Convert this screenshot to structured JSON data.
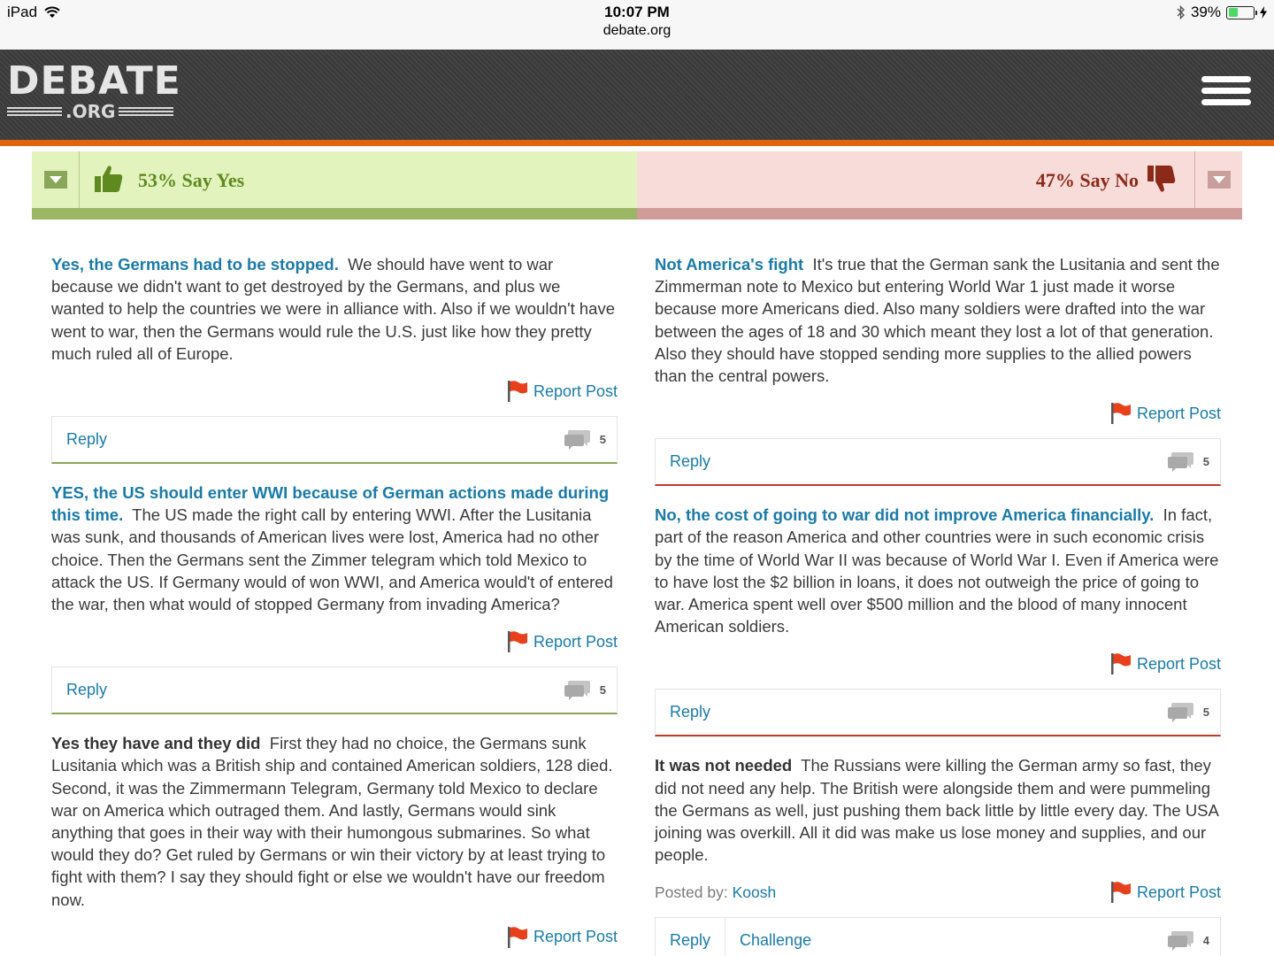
{
  "status_bar": {
    "device": "iPad",
    "time": "10:07 PM",
    "url": "debate.org",
    "battery": "39%",
    "battery_level": 0.39
  },
  "header": {
    "logo_main": "DEBATE",
    "logo_sub": ".ORG"
  },
  "colors": {
    "accent_orange": "#e1640f",
    "yes_green": "#5f8a1f",
    "no_red": "#8c2a1a",
    "link_blue": "#1a7aa8"
  },
  "vote": {
    "yes_label": "53% Say Yes",
    "no_label": "47% Say No",
    "yes_percent": 53,
    "no_percent": 47
  },
  "yes_arguments": [
    {
      "title": "Yes, the Germans had to be stopped.",
      "body": "We should have went to war because we didn't want to get destroyed by the Germans, and plus we wanted to help the countries we were in alliance with. Also if we wouldn't have went to war, then the Germans would rule the U.S. just like how they pretty much ruled all of Europe.",
      "report": "Report Post",
      "reply": "Reply",
      "comments": "5"
    },
    {
      "title": "YES, the US should enter WWI because of German actions made during this time.",
      "body": "The US made the right call by entering WWI. After the Lusitania was sunk, and thousands of American lives were lost, America had no other choice. Then the Germans sent the Zimmer telegram which told Mexico to attack the US. If Germany would of won WWI, and America would't of entered the war, then what would of stopped Germany from invading America?",
      "report": "Report Post",
      "reply": "Reply",
      "comments": "5"
    },
    {
      "title": "Yes they have and they did",
      "body": "First they had no choice, the Germans sunk Lusitania which was a British ship and contained American soldiers, 128 died. Second, it was the Zimmermann Telegram, Germany told Mexico to declare war on America which outraged them. And lastly, Germans would sink anything that goes in their way with their humongous submarines. So what would they do? Get ruled by Germans or win their victory by at least trying to fight with them? I say they should fight or else we wouldn't have our freedom now.",
      "report": "Report Post"
    }
  ],
  "no_arguments": [
    {
      "title": "Not America's fight",
      "body": "It's true that the German sank the Lusitania and sent the Zimmerman note to Mexico but entering World War 1 just made it worse because more Americans died. Also many soldiers were drafted into the war between the ages of 18 and 30 which meant they lost a lot of that generation. Also they should have stopped sending more supplies to the allied powers than the central powers.",
      "report": "Report Post",
      "reply": "Reply",
      "comments": "5"
    },
    {
      "title": "No, the cost of going to war did not improve America financially.",
      "body": "In fact, part of the reason America and other countries were in such economic crisis by the time of World War II was because of World War I. Even if America were to have lost the $2 billion in loans, it does not outweigh the price of going to war. America spent well over $500 million and the blood of many innocent American soldiers.",
      "report": "Report Post",
      "reply": "Reply",
      "comments": "5"
    },
    {
      "title": "It was not needed",
      "body": "The Russians were killing the German army so fast, they did not need any help. The British were alongside them and were pummeling the Germans as well, just pushing them back little by little every day. The USA joining was overkill. All it did was make us lose money and supplies, and our people.",
      "posted_by_label": "Posted by:",
      "posted_by_user": "Koosh",
      "report": "Report Post",
      "reply": "Reply",
      "challenge": "Challenge",
      "comments": "4"
    }
  ]
}
